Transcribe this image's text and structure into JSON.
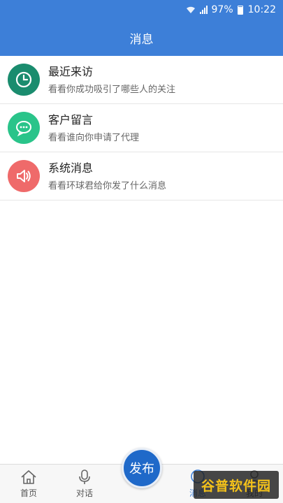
{
  "status_bar": {
    "battery": "97%",
    "time": "10:22"
  },
  "header": {
    "title": "消息"
  },
  "messages": [
    {
      "title": "最近来访",
      "subtitle": "看看你成功吸引了哪些人的关注",
      "icon": "clock-icon",
      "color": "#1a8c6e"
    },
    {
      "title": "客户留言",
      "subtitle": "看看谁向你申请了代理",
      "icon": "chat-bubble-icon",
      "color": "#2ac48a"
    },
    {
      "title": "系统消息",
      "subtitle": "看看环球君给你发了什么消息",
      "icon": "speaker-icon",
      "color": "#ef6a6a"
    }
  ],
  "tab_bar": {
    "home": "首页",
    "chat": "对话",
    "publish": "发布",
    "messages": "消息",
    "mine": "我的"
  },
  "watermark": "谷普软件园",
  "colors": {
    "primary": "#3d7fd8",
    "publish": "#1f69c9"
  }
}
